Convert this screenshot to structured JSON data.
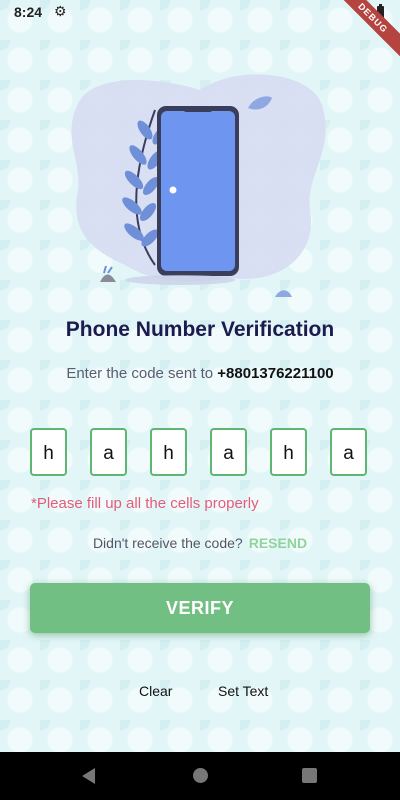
{
  "status_bar": {
    "time": "8:24",
    "debug_label": "DEBUG"
  },
  "header": {
    "title": "Phone Number Verification",
    "subtitle_prefix": "Enter the code sent to ",
    "phone_number": "+8801376221100"
  },
  "otp": {
    "cells": [
      "h",
      "a",
      "h",
      "a",
      "h",
      "a"
    ],
    "error": "*Please fill up all the cells properly"
  },
  "resend": {
    "prompt": "Didn't receive the code?",
    "action": "RESEND"
  },
  "verify_button": {
    "label": "VERIFY"
  },
  "actions": {
    "clear": "Clear",
    "set_text": "Set Text"
  },
  "colors": {
    "accent_green": "#72bf83",
    "resend_green": "#8fd49e",
    "error_pink": "#e45c7a",
    "title_navy": "#1d1b4d",
    "phone_screen_blue": "#6e96f0"
  },
  "icons": [
    "gear-icon",
    "battery-icon",
    "nav-back-icon",
    "nav-home-icon",
    "nav-recent-icon"
  ]
}
